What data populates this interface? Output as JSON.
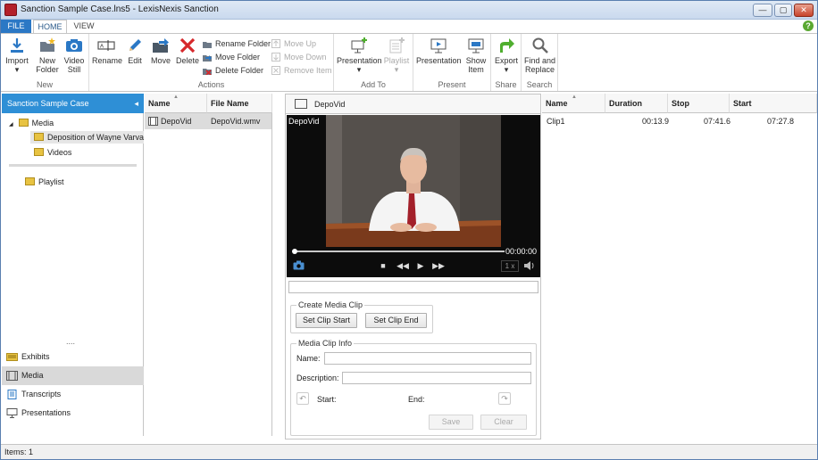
{
  "window": {
    "title": "Sanction Sample Case.lns5 - LexisNexis Sanction",
    "minimize": "—",
    "maximize": "▢",
    "close": "✕"
  },
  "tabs": {
    "file": "FILE",
    "home": "HOME",
    "view": "VIEW"
  },
  "help": "?",
  "ribbon": {
    "new": {
      "label": "New",
      "import": "Import",
      "new_folder": [
        "New",
        "Folder"
      ],
      "video_still": [
        "Video",
        "Still"
      ]
    },
    "actions": {
      "label": "Actions",
      "rename": "Rename",
      "edit": "Edit",
      "move": "Move",
      "delete": "Delete",
      "rename_folder": "Rename Folder",
      "move_folder": "Move Folder",
      "delete_folder": "Delete Folder",
      "move_up": "Move Up",
      "move_down": "Move Down",
      "remove_item": "Remove Item"
    },
    "add_to": {
      "label": "Add To",
      "presentation": "Presentation",
      "playlist": "Playlist"
    },
    "present": {
      "label": "Present",
      "presentation": "Presentation",
      "show_item": [
        "Show",
        "Item"
      ]
    },
    "share": {
      "label": "Share",
      "export": "Export"
    },
    "search": {
      "label": "Search",
      "find_replace": [
        "Find and",
        "Replace"
      ]
    }
  },
  "case_panel": {
    "header": "Sanction Sample Case",
    "collapse": "◂",
    "tree": {
      "expander": "◢",
      "media": "Media",
      "deposition": "Deposition of Wayne Varvar",
      "videos": "Videos",
      "playlist": "Playlist"
    },
    "splitter": "....",
    "nav": [
      {
        "label": "Exhibits"
      },
      {
        "label": "Media"
      },
      {
        "label": "Transcripts"
      },
      {
        "label": "Presentations"
      }
    ]
  },
  "file_list": {
    "columns": [
      "Name",
      "File Name"
    ],
    "rows": [
      {
        "name": "DepoVid",
        "file_name": "DepoVid.wmv"
      }
    ]
  },
  "media": {
    "header": "DepoVid",
    "video_label": "DepoVid",
    "timecode": "00:00:00",
    "progress": 0,
    "speed": "1 x",
    "create_clip": {
      "title": "Create Media Clip",
      "set_start": "Set Clip Start",
      "set_end": "Set Clip End"
    },
    "clip_info": {
      "title": "Media Clip Info",
      "name_label": "Name:",
      "description_label": "Description:",
      "start_label": "Start:",
      "end_label": "End:",
      "save": "Save",
      "clear": "Clear"
    }
  },
  "clips": {
    "columns": [
      "Name",
      "Duration",
      "Stop",
      "Start"
    ],
    "rows": [
      {
        "name": "Clip1",
        "duration": "00:13.9",
        "stop": "07:41.6",
        "start": "07:27.8"
      }
    ]
  },
  "status": {
    "text": "Items: 1"
  },
  "colors": {
    "accent": "#2e8fd6",
    "file_tab": "#2b78c5",
    "folder": "#e8c342",
    "delete": "#d6282b",
    "add": "#4fae2e"
  }
}
